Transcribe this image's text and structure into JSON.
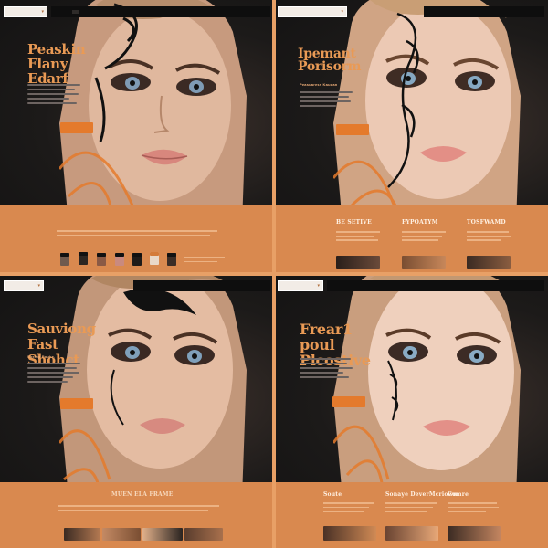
{
  "panels": [
    {
      "nav": {
        "search_label": "",
        "links": [
          "",
          "",
          "",
          "",
          ""
        ]
      },
      "headline": "Peaskin Flany Edarf",
      "button_label": ""
    },
    {
      "nav": {
        "search_label": "",
        "links": [
          "",
          "",
          "",
          ""
        ]
      },
      "headline": "Ipemant Porisorm",
      "subhead": "Peasuaress Kauqan",
      "button_label": "",
      "features": [
        "BE SETIVE",
        "FYPOATYM",
        "TOSFWAMD"
      ],
      "feature_buttons": [
        "",
        "",
        ""
      ]
    },
    {
      "nav": {
        "search_label": "",
        "links": [
          "",
          "",
          ""
        ]
      },
      "headline": "Sauviong Fast Shohct",
      "subhead": "Sbenip Pouhe.",
      "button_label": "",
      "section_title": "MUEN ELA FRAME"
    },
    {
      "nav": {
        "search_label": "",
        "links": [
          "",
          "",
          "",
          ""
        ]
      },
      "headline": "Frear1 poul Plcostive",
      "button_label": "",
      "features": [
        "Soute",
        "Sonaye DeverMcriown",
        "Comre"
      ]
    }
  ],
  "colors": {
    "accent": "#e47a2c",
    "headline": "#e99a55",
    "section_bg": "#d9894f",
    "dark": "#141313"
  }
}
